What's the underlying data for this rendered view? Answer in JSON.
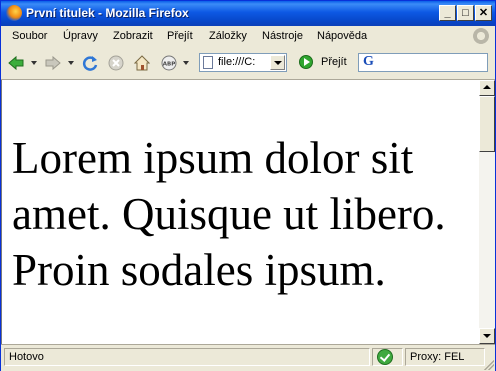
{
  "window": {
    "title": "První titulek - Mozilla Firefox"
  },
  "title_buttons": {
    "minimize": "_",
    "maximize": "□",
    "close": "✕"
  },
  "menu": [
    "Soubor",
    "Úpravy",
    "Zobrazit",
    "Přejít",
    "Záložky",
    "Nástroje",
    "Nápověda"
  ],
  "toolbar": {
    "url": "file:///C:",
    "go_label": "Přejít",
    "icons": [
      "back-icon",
      "forward-icon",
      "reload-icon",
      "stop-icon",
      "home-icon",
      "adblock-icon",
      "page-icon",
      "go-icon",
      "google-icon"
    ],
    "search_logo": "G"
  },
  "content": {
    "text": "Lorem ipsum dolor sit amet. Quisque ut libero. Proin sodales ipsum."
  },
  "status": {
    "text": "Hotovo",
    "proxy": "Proxy: FEL"
  },
  "colors": {
    "title_bar": "#0a5fe8",
    "chrome": "#ece9d8",
    "go_green": "#2fa52f"
  }
}
